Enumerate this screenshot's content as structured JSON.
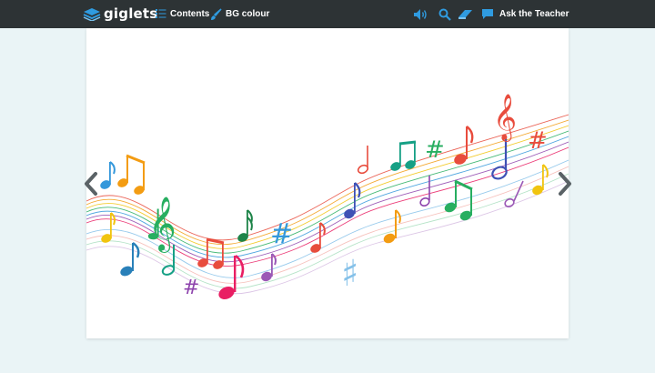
{
  "header": {
    "logo_text": "giglets",
    "contents_label": "Contents",
    "bg_colour_label": "BG colour",
    "ask_teacher_label": "Ask the Teacher"
  },
  "icons": {
    "logo": "book-icon",
    "contents": "list-icon",
    "bg_colour": "paintbrush-icon",
    "audio": "speaker-icon",
    "search": "search-icon",
    "eraser": "eraser-icon",
    "chat": "chat-bubble-icon",
    "prev": "chevron-left-icon",
    "next": "chevron-right-icon"
  },
  "colors": {
    "header_bg": "#2d3335",
    "accent": "#2f9be0",
    "page_bg": "#eaf4f6",
    "arrow": "#5a6266"
  },
  "illustration": {
    "subject": "colorful-music-notes-on-waving-staff",
    "note_colors": [
      "#e84c3d",
      "#f39c12",
      "#f1c40f",
      "#27ae60",
      "#16a085",
      "#2980b9",
      "#3498db",
      "#8e44ad",
      "#9b59b6",
      "#e91e63",
      "#85c1e9",
      "#d35400",
      "#7ac943"
    ]
  }
}
